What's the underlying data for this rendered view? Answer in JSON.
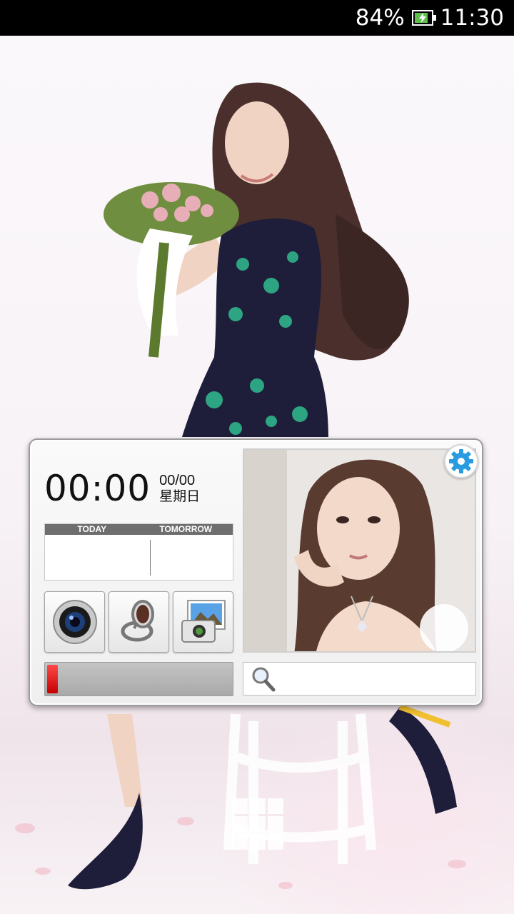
{
  "status_bar": {
    "battery_text": "84%",
    "battery_level": 0.84,
    "time": "11:30",
    "battery_icon": "battery-charging-icon"
  },
  "widget": {
    "clock": {
      "time": "00:00",
      "date": "00/00",
      "weekday": "星期日"
    },
    "weather": {
      "today_label": "TODAY",
      "tomorrow_label": "TOMORROW"
    },
    "apps": [
      {
        "name": "camera",
        "icon": "camera-lens-icon"
      },
      {
        "name": "mirror",
        "icon": "mirror-icon"
      },
      {
        "name": "gallery",
        "icon": "gallery-icon"
      }
    ],
    "battery_bar": {
      "level": 0.06,
      "color": "#d60000"
    },
    "settings_icon": "gear-icon",
    "search": {
      "placeholder": "",
      "icon": "magnifier-icon"
    }
  },
  "dock": {
    "icon": "app-drawer-grid-icon"
  },
  "colors": {
    "status_bar_bg": "#000000",
    "gear_blue": "#2a9be0",
    "dress_teal": "#2fb38a"
  }
}
